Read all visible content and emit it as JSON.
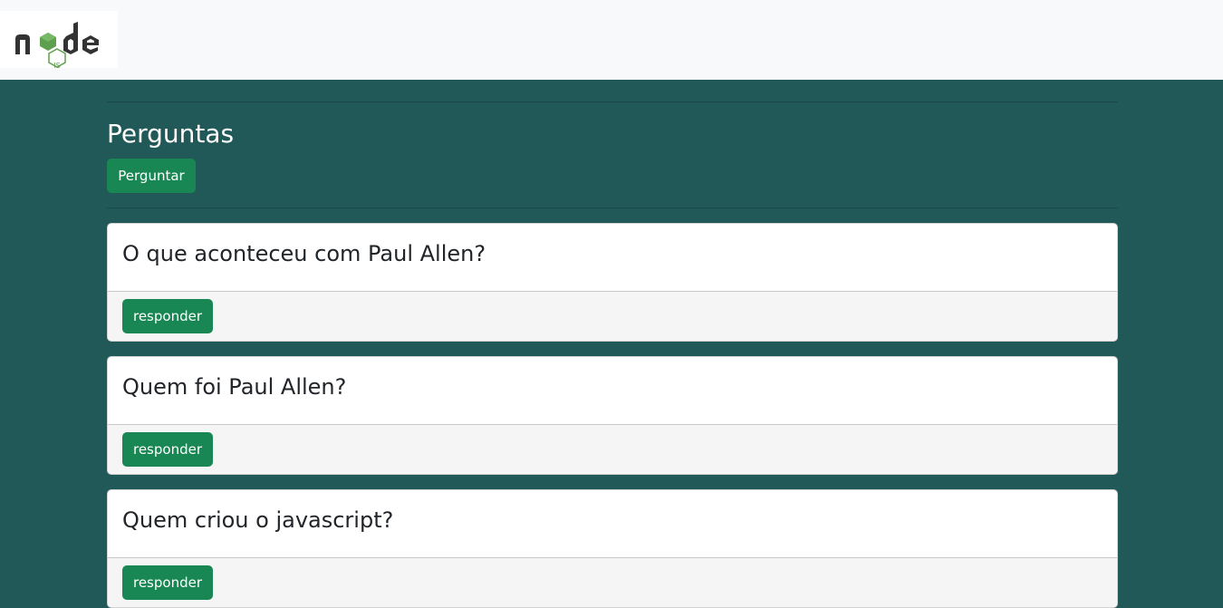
{
  "navbar": {
    "logo": {
      "icon": "nodejs-logo",
      "text": "node",
      "badge": "JS",
      "brand_color": "#5FA04E",
      "text_color": "#333333"
    }
  },
  "page": {
    "title": "Perguntas",
    "ask_button_label": "Perguntar",
    "background_color": "#215958",
    "accent_color": "#198754"
  },
  "questions": [
    {
      "title": "O que aconteceu com Paul Allen?",
      "answer_label": "responder"
    },
    {
      "title": "Quem foi Paul Allen?",
      "answer_label": "responder"
    },
    {
      "title": "Quem criou o javascript?",
      "answer_label": "responder"
    }
  ]
}
